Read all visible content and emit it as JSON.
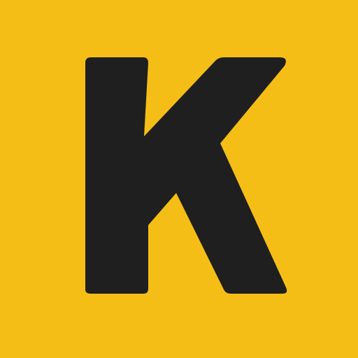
{
  "icon": {
    "letter": "K",
    "background_color": "#F4BE17",
    "glyph_color": "#1F1F1F",
    "glyph_name": "letter-k-logo"
  }
}
